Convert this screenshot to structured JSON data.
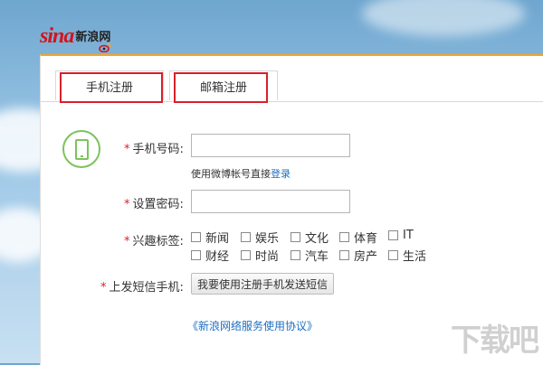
{
  "header": {
    "logo_text": "sina",
    "logo_cn": "新浪网"
  },
  "tabs": [
    {
      "label": "手机注册"
    },
    {
      "label": "邮箱注册"
    }
  ],
  "form": {
    "phone_label": "手机号码:",
    "phone_value": "",
    "hint_text": "使用微博帐号直接",
    "hint_link": "登录",
    "password_label": "设置密码:",
    "password_value": "",
    "interests_label": "兴趣标签:",
    "interests": [
      "新闻",
      "娱乐",
      "文化",
      "体育",
      "IT",
      "财经",
      "时尚",
      "汽车",
      "房产",
      "生活"
    ],
    "sms_label": "上发短信手机:",
    "sms_button": "我要使用注册手机发送短信",
    "required_mark": "*"
  },
  "footer": {
    "agreement": "《新浪网络服务使用协议》",
    "watermark": "下载吧"
  },
  "colors": {
    "accent": "#f5a623",
    "highlight": "#d9202a",
    "link": "#1d6fbf",
    "icon_green": "#7cc35b"
  }
}
